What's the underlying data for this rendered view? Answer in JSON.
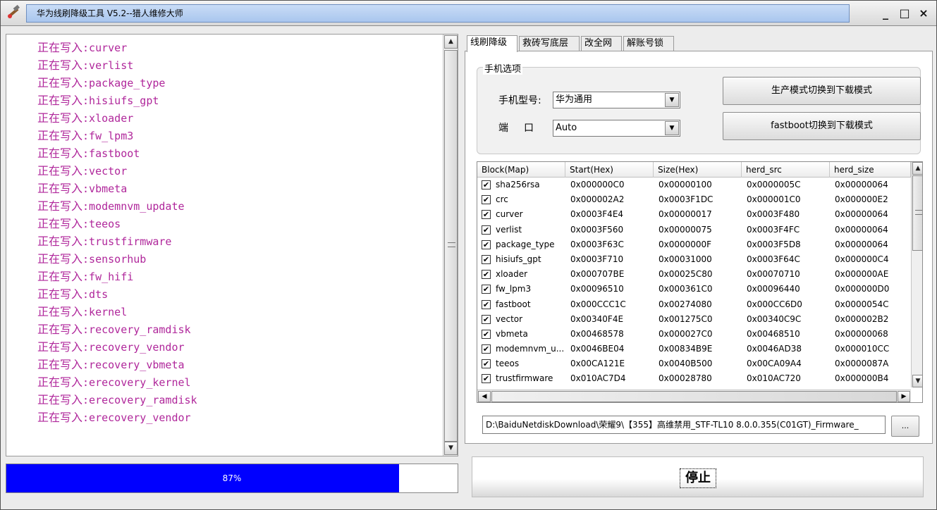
{
  "window": {
    "title": "华为线刷降级工具 V5.2--猎人维修大师",
    "controls": {
      "minimize": "_",
      "maximize": "□",
      "close": "×"
    }
  },
  "log": {
    "prefix": "正在写入",
    "separator": ":",
    "lines": [
      "curver",
      "verlist",
      "package_type",
      "hisiufs_gpt",
      "xloader",
      "fw_lpm3",
      "fastboot",
      "vector",
      "vbmeta",
      "modemnvm_update",
      "teeos",
      "trustfirmware",
      "sensorhub",
      "fw_hifi",
      "dts",
      "kernel",
      "recovery_ramdisk",
      "recovery_vendor",
      "recovery_vbmeta",
      "erecovery_kernel",
      "erecovery_ramdisk",
      "erecovery_vendor"
    ]
  },
  "progress": {
    "value": 0.87,
    "label": "87%"
  },
  "tabs": [
    "线刷降级",
    "救砖写底层",
    "改全网",
    "解账号锁"
  ],
  "phone_options": {
    "legend": "手机选项",
    "model_label": "手机型号:",
    "model_value": "华为通用",
    "port_label": "端　口",
    "port_value": "Auto",
    "btn_prod_to_download": "生产模式切换到下载模式",
    "btn_fastboot_to_download": "fastboot切换到下载模式"
  },
  "table": {
    "columns": [
      "Block(Map)",
      "Start(Hex)",
      "Size(Hex)",
      "herd_src",
      "herd_size"
    ],
    "rows": [
      {
        "checked": true,
        "block": "sha256rsa",
        "start": "0x000000C0",
        "size": "0x00000100",
        "src": "0x0000005C",
        "hsize": "0x00000064"
      },
      {
        "checked": true,
        "block": "crc",
        "start": "0x000002A2",
        "size": "0x0003F1DC",
        "src": "0x000001C0",
        "hsize": "0x000000E2"
      },
      {
        "checked": true,
        "block": "curver",
        "start": "0x0003F4E4",
        "size": "0x00000017",
        "src": "0x0003F480",
        "hsize": "0x00000064"
      },
      {
        "checked": true,
        "block": "verlist",
        "start": "0x0003F560",
        "size": "0x00000075",
        "src": "0x0003F4FC",
        "hsize": "0x00000064"
      },
      {
        "checked": true,
        "block": "package_type",
        "start": "0x0003F63C",
        "size": "0x0000000F",
        "src": "0x0003F5D8",
        "hsize": "0x00000064"
      },
      {
        "checked": true,
        "block": "hisiufs_gpt",
        "start": "0x0003F710",
        "size": "0x00031000",
        "src": "0x0003F64C",
        "hsize": "0x000000C4"
      },
      {
        "checked": true,
        "block": "xloader",
        "start": "0x000707BE",
        "size": "0x00025C80",
        "src": "0x00070710",
        "hsize": "0x000000AE"
      },
      {
        "checked": true,
        "block": "fw_lpm3",
        "start": "0x00096510",
        "size": "0x000361C0",
        "src": "0x00096440",
        "hsize": "0x000000D0"
      },
      {
        "checked": true,
        "block": "fastboot",
        "start": "0x000CCC1C",
        "size": "0x00274080",
        "src": "0x000CC6D0",
        "hsize": "0x0000054C"
      },
      {
        "checked": true,
        "block": "vector",
        "start": "0x00340F4E",
        "size": "0x001275C0",
        "src": "0x00340C9C",
        "hsize": "0x000002B2"
      },
      {
        "checked": true,
        "block": "vbmeta",
        "start": "0x00468578",
        "size": "0x000027C0",
        "src": "0x00468510",
        "hsize": "0x00000068"
      },
      {
        "checked": true,
        "block": "modemnvm_u...",
        "start": "0x0046BE04",
        "size": "0x00834B9E",
        "src": "0x0046AD38",
        "hsize": "0x000010CC"
      },
      {
        "checked": true,
        "block": "teeos",
        "start": "0x00CA121E",
        "size": "0x0040B500",
        "src": "0x00CA09A4",
        "hsize": "0x0000087A"
      },
      {
        "checked": true,
        "block": "trustfirmware",
        "start": "0x010AC7D4",
        "size": "0x00028780",
        "src": "0x010AC720",
        "hsize": "0x000000B4"
      }
    ]
  },
  "firmware_path": "D:\\BaiduNetdiskDownload\\荣耀9\\【355】高维禁用_STF-TL10 8.0.0.355(C01GT)_Firmware_",
  "browse_label": "...",
  "stop_label": "停止",
  "colors": {
    "log_text": "#b0279b",
    "progress_fill": "#0000ff",
    "title_field": "#b9d2f3"
  }
}
